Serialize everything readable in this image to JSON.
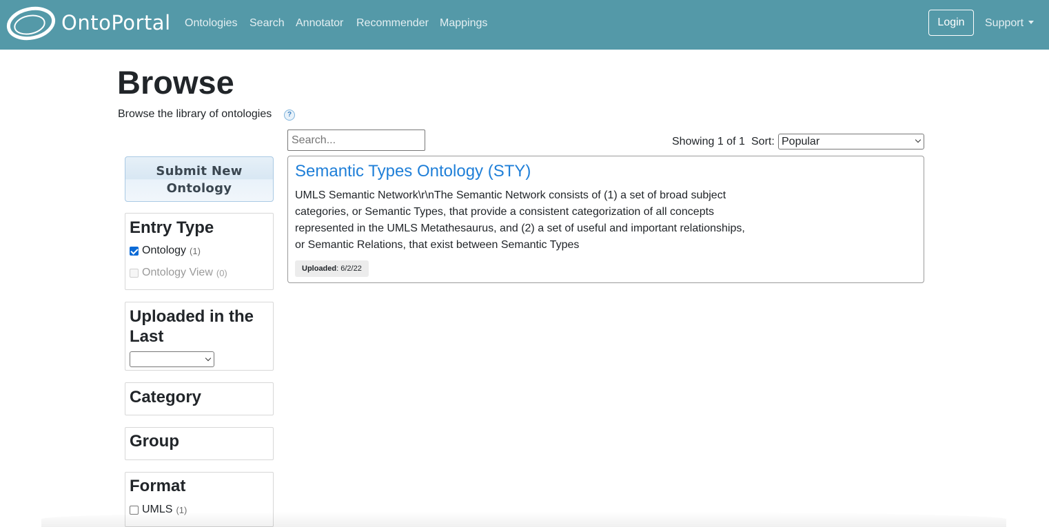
{
  "navbar": {
    "brand": "OntoPortal",
    "links": [
      "Ontologies",
      "Search",
      "Annotator",
      "Recommender",
      "Mappings"
    ],
    "login_label": "Login",
    "support_label": "Support",
    "background_color": "#5499a8"
  },
  "page": {
    "title": "Browse",
    "subtitle": "Browse the library of ontologies",
    "help_icon": "question-mark-icon"
  },
  "sidebar": {
    "submit_button": {
      "line1": "Submit New",
      "line2": "Ontology"
    },
    "facets": {
      "entry_type": {
        "title": "Entry Type",
        "options": [
          {
            "label": "Ontology",
            "count": "(1)",
            "checked": true,
            "disabled": false
          },
          {
            "label": "Ontology View",
            "count": "(0)",
            "checked": false,
            "disabled": true
          }
        ]
      },
      "uploaded": {
        "title_line1": "Uploaded in the",
        "title_line2": "Last",
        "selected": ""
      },
      "category": {
        "title": "Category"
      },
      "group": {
        "title": "Group"
      },
      "format": {
        "title": "Format",
        "options": [
          {
            "label": "UMLS",
            "count": "(1)",
            "checked": false
          }
        ]
      }
    }
  },
  "main": {
    "search_placeholder": "Search...",
    "showing": "Showing 1 of 1",
    "sort_label": "Sort:",
    "sort_selected": "Popular",
    "results": [
      {
        "title": "Semantic Types Ontology (STY)",
        "description_lines": [
          "UMLS Semantic Network\\r\\nThe Semantic Network consists of (1) a set of broad subject",
          "categories, or Semantic Types, that provide a consistent categorization of all concepts",
          "represented in the UMLS Metathesaurus, and (2) a set of useful and important relationships,",
          "or Semantic Relations, that exist between Semantic Types"
        ],
        "uploaded_label": "Uploaded",
        "uploaded_date": ": 6/2/22"
      }
    ]
  },
  "colors": {
    "link": "#1f7fd8",
    "checkbox_checked": "#0b6ad6"
  }
}
